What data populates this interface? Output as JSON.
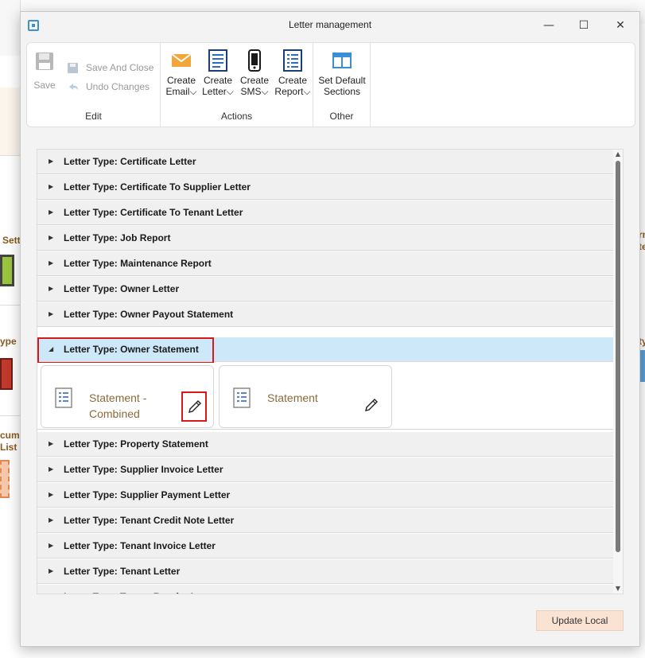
{
  "background": {
    "items": [
      {
        "label": "Sett",
        "color": "#8a5a1e"
      },
      {
        "label": "ype",
        "color": "#8a5a1e"
      },
      {
        "label": "cume",
        "color": "#8a5a1e"
      },
      {
        "label": "List",
        "color": "#8a5a1e"
      },
      {
        "label": "rn",
        "color": "#8a5a1e"
      },
      {
        "label": "te",
        "color": "#8a5a1e"
      },
      {
        "label": "ty",
        "color": "#8a5a1e"
      }
    ]
  },
  "window": {
    "title": "Letter management",
    "icon": "app-window-icon",
    "controls": {
      "minimize": "—",
      "maximize": "☐",
      "close": "✕"
    }
  },
  "ribbon": {
    "groups": [
      {
        "label": "Edit",
        "buttons": [
          {
            "label": "Save",
            "icon": "save-icon",
            "enabled": false
          }
        ],
        "small_buttons": [
          {
            "label": "Save And Close",
            "icon": "save-close-icon",
            "enabled": false
          },
          {
            "label": "Undo Changes",
            "icon": "undo-icon",
            "enabled": false
          }
        ]
      },
      {
        "label": "Actions",
        "buttons": [
          {
            "line1": "Create",
            "line2": "Email",
            "dropdown": "⌵",
            "icon": "email-icon"
          },
          {
            "line1": "Create",
            "line2": "Letter",
            "dropdown": "⌵",
            "icon": "letter-icon"
          },
          {
            "line1": "Create",
            "line2": "SMS",
            "dropdown": "⌵",
            "icon": "sms-icon"
          },
          {
            "line1": "Create",
            "line2": "Report",
            "dropdown": "⌵",
            "icon": "report-icon"
          }
        ]
      },
      {
        "label": "Other",
        "buttons": [
          {
            "line1": "Set Default",
            "line2": "Sections",
            "icon": "sections-icon"
          }
        ]
      }
    ]
  },
  "letter_types": [
    {
      "label": "Letter Type: Certificate Letter",
      "expanded": false
    },
    {
      "label": "Letter Type: Certificate To Supplier Letter",
      "expanded": false
    },
    {
      "label": "Letter Type: Certificate To Tenant Letter",
      "expanded": false
    },
    {
      "label": "Letter Type: Job Report",
      "expanded": false
    },
    {
      "label": "Letter Type: Maintenance Report",
      "expanded": false
    },
    {
      "label": "Letter Type: Owner Letter",
      "expanded": false
    },
    {
      "label": "Letter Type: Owner Payout Statement",
      "expanded": false
    },
    {
      "label": "Letter Type: Owner Statement",
      "expanded": true,
      "selected": true
    },
    {
      "label": "Letter Type: Property Statement",
      "expanded": false
    },
    {
      "label": "Letter Type: Supplier Invoice Letter",
      "expanded": false
    },
    {
      "label": "Letter Type: Supplier Payment Letter",
      "expanded": false
    },
    {
      "label": "Letter Type: Tenant Credit Note Letter",
      "expanded": false
    },
    {
      "label": "Letter Type: Tenant Invoice Letter",
      "expanded": false
    },
    {
      "label": "Letter Type: Tenant Letter",
      "expanded": false
    },
    {
      "label": "Letter Type: Tenant Receipt Letter",
      "expanded": false
    }
  ],
  "templates": [
    {
      "line1": "Statement -",
      "line2": "Combined",
      "icon": "document-icon",
      "edit_icon": "pencil-icon"
    },
    {
      "line1": "Statement",
      "line2": "",
      "icon": "document-icon",
      "edit_icon": "pencil-icon"
    }
  ],
  "carets": {
    "collapsed": "▶",
    "expanded": "◢"
  },
  "scrollbar": {
    "up": "▲",
    "down": "▼"
  },
  "footer": {
    "update_label": "Update Local"
  },
  "colors": {
    "accent": "#3a8fd6",
    "selection": "#cde8f9",
    "highlight_border": "#d7191c",
    "template_text": "#8c6a3a",
    "update_button": "#fbe3d4"
  }
}
